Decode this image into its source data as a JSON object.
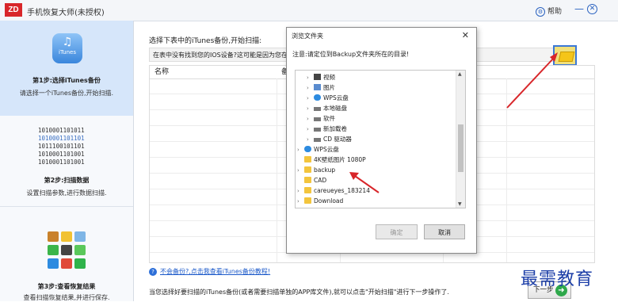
{
  "app": {
    "logo": "ZD",
    "title": "手机恢复大师(未授权)",
    "help_label": "帮助",
    "minimize": "—",
    "close": "✕"
  },
  "sidebar": {
    "itunes_icon_label": "iTunes",
    "step1": {
      "title": "第1步:选择iTunes备份",
      "desc": "请选择一个iTunes备份,开始扫描."
    },
    "binary": [
      "1010001101011",
      "1010001101101",
      "1011100101101",
      "1010001101001",
      "1010001101001"
    ],
    "step2": {
      "title": "第2步:扫描数据",
      "desc": "设置扫描参数,进行数据扫描."
    },
    "step3": {
      "title": "第3步:查看恢复结果",
      "desc": "查看扫描恢复结果,并进行保存."
    }
  },
  "main": {
    "prompt": "选择下表中的iTunes备份,开始扫描:",
    "info_text": "在表中没有找到您的IOS设备?这可能是因为您在备份",
    "columns": [
      "名称",
      "备"
    ],
    "help_link": "不会备份?,点击我查看iTunes备份教程!",
    "bottom_text": "当您选择好要扫描的iTunes备份(或者需要扫描单独的APP库文件),就可以点击\"开始扫描\"进行下一步操作了.",
    "next_label": "下一步"
  },
  "dialog": {
    "title": "浏览文件夹",
    "instruction": "注意:请定位到Backup文件夹所在的目录!",
    "tree": [
      {
        "label": "视频",
        "icon": "video-icon"
      },
      {
        "label": "图片",
        "icon": "picture-icon"
      },
      {
        "label": "WPS云盘",
        "icon": "cloud-icon"
      },
      {
        "label": "本地磁盘",
        "icon": "drive-icon"
      },
      {
        "label": "软件",
        "icon": "drive-icon"
      },
      {
        "label": "新加载卷",
        "icon": "drive-icon"
      },
      {
        "label": "CD 驱动器",
        "icon": "cd-icon"
      },
      {
        "label": "WPS云盘",
        "icon": "cloud-icon"
      },
      {
        "label": "4K壁纸图片 1080P",
        "icon": "folder-icon"
      },
      {
        "label": "backup",
        "icon": "folder-icon"
      },
      {
        "label": "CAD",
        "icon": "folder-icon"
      },
      {
        "label": "careueyes_183214",
        "icon": "folder-icon"
      },
      {
        "label": "Download",
        "icon": "folder-icon"
      }
    ],
    "ok_label": "确定",
    "cancel_label": "取消"
  },
  "watermark": "最需教育",
  "colors": {
    "accent": "#2a62c0",
    "arrow": "#d8262a",
    "sidebar_active": "#d6e6fa"
  }
}
